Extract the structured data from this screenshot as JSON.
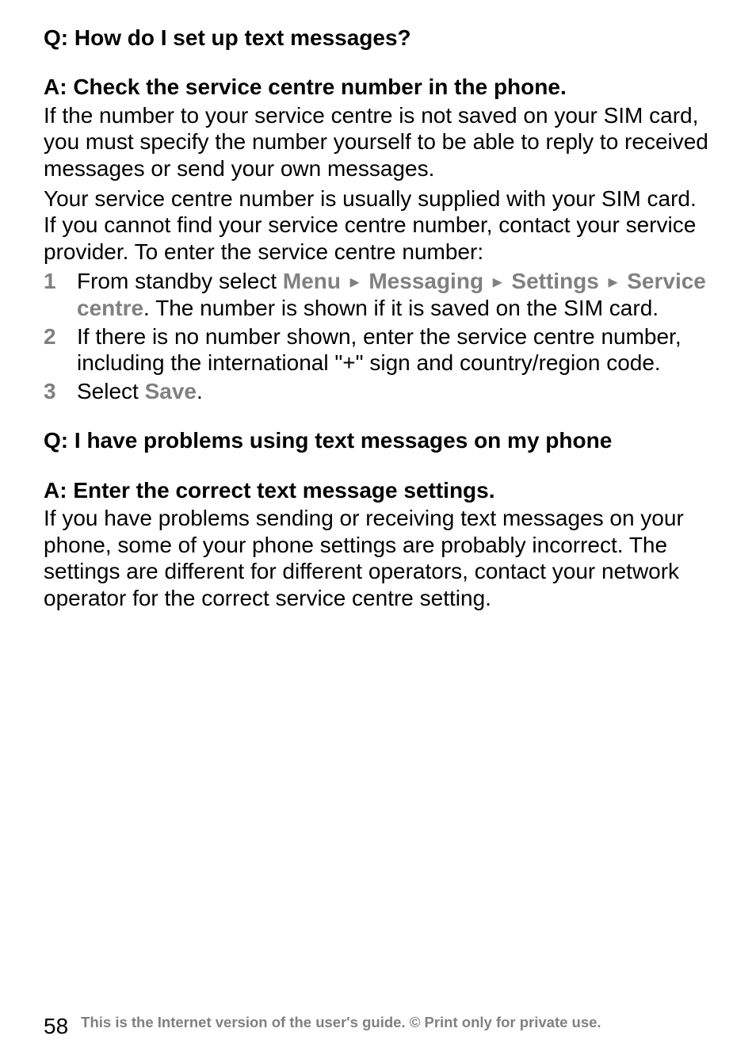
{
  "q1": {
    "question": "Q: How do I set up text messages?",
    "answer_heading": "A: Check the service centre number in the phone.",
    "para1": "If the number to your service centre is not saved on your SIM card, you must specify the number yourself to be able to reply to received messages or send your own messages.",
    "para2": "Your service centre number is usually supplied with your SIM card. If you cannot find your service centre number, contact your service provider. To enter the service centre number:",
    "steps": [
      {
        "num": "1",
        "prefix": "From standby select ",
        "menu1": "Menu",
        "menu2": "Messaging",
        "menu3": "Settings",
        "menu4": "Service centre",
        "suffix": ". The number is shown if it is saved on the SIM card."
      },
      {
        "num": "2",
        "text": "If there is no number shown, enter the service centre number, including the international \"+\" sign and country/region code."
      },
      {
        "num": "3",
        "prefix": "Select ",
        "menu1": "Save",
        "suffix": "."
      }
    ]
  },
  "q2": {
    "question": "Q: I have problems using text messages on my phone",
    "answer_heading": "A: Enter the correct text message settings.",
    "para1": "If you have problems sending or receiving text messages on your phone, some of your phone settings are probably incorrect. The settings are different for different operators, contact your network operator for the correct service centre setting."
  },
  "footer": {
    "page": "58",
    "text": "This is the Internet version of the user's guide. © Print only for private use."
  },
  "arrow_glyph": "►"
}
